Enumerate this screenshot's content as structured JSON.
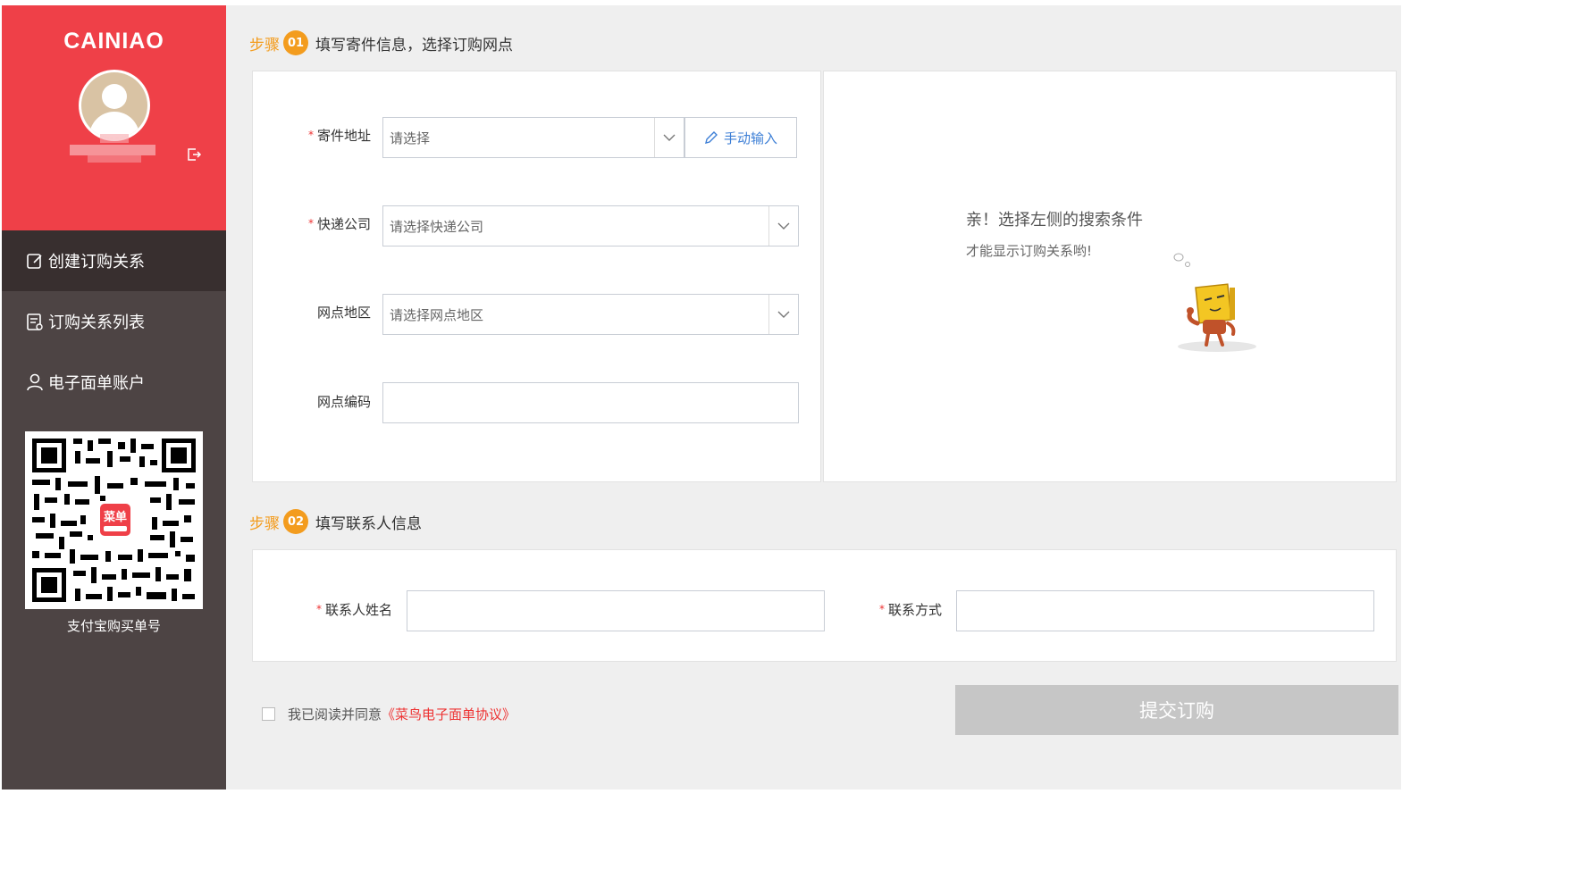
{
  "sidebar": {
    "brand": "CAINIAO",
    "nav": [
      {
        "label": "创建订购关系",
        "icon": "edit-icon",
        "active": true
      },
      {
        "label": "订购关系列表",
        "icon": "list-icon",
        "active": false
      },
      {
        "label": "电子面单账户",
        "icon": "user-icon",
        "active": false
      }
    ],
    "qr_caption": "支付宝购买单号",
    "qr_badge": "菜单"
  },
  "step1": {
    "label": "步骤",
    "number": "01",
    "title": "填写寄件信息，选择订购网点",
    "fields": {
      "sender_address": {
        "label": "寄件地址",
        "required": true,
        "placeholder": "请选择"
      },
      "manual_input_label": "手动输入",
      "courier": {
        "label": "快递公司",
        "required": true,
        "placeholder": "请选择快递公司"
      },
      "branch_region": {
        "label": "网点地区",
        "required": false,
        "placeholder": "请选择网点地区"
      },
      "branch_code": {
        "label": "网点编码",
        "required": false,
        "value": ""
      }
    },
    "empty_state": {
      "title": "亲！选择左侧的搜索条件",
      "subtitle": "才能显示订购关系哟!"
    }
  },
  "step2": {
    "label": "步骤",
    "number": "02",
    "title": "填写联系人信息",
    "fields": {
      "contact_name": {
        "label": "联系人姓名",
        "required": true,
        "value": ""
      },
      "contact_method": {
        "label": "联系方式",
        "required": true,
        "value": ""
      }
    }
  },
  "footer": {
    "agree_text": "我已阅读并同意",
    "agree_link": "《菜鸟电子面单协议》",
    "submit_label": "提交订购"
  },
  "colors": {
    "brand_red": "#ef4048",
    "sidebar_bg": "#4d4444",
    "step_orange": "#f39c1e",
    "link_blue": "#3d7fd6"
  }
}
